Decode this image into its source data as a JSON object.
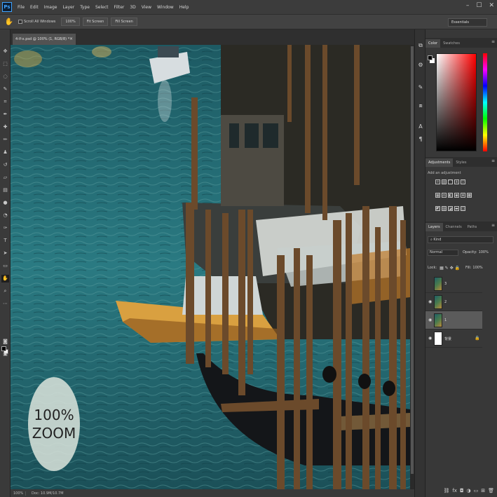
{
  "app": {
    "logo": "Ps"
  },
  "menu": [
    "File",
    "Edit",
    "Image",
    "Layer",
    "Type",
    "Select",
    "Filter",
    "3D",
    "View",
    "Window",
    "Help"
  ],
  "window_controls": {
    "minimize": "–",
    "restore": "☐",
    "close": "✕"
  },
  "options": {
    "tool_icon": "hand-icon",
    "scroll_all_label": "Scroll All Windows",
    "btn_100": "100%",
    "btn_fit": "Fit Screen",
    "btn_fill": "Fill Screen",
    "workspace": "Essentials"
  },
  "document": {
    "tab_title": "4-lf-x.psd @ 100% (1, RGB/8) *",
    "close": "×",
    "zoom_text_line1": "100%",
    "zoom_text_line2": "ZOOM"
  },
  "status": {
    "zoom": "100%",
    "doc": "Doc: 10.9M/10.7M"
  },
  "color_panel": {
    "tabs": [
      "Color",
      "Swatches"
    ]
  },
  "adjustments_panel": {
    "tabs": [
      "Adjustments",
      "Styles"
    ],
    "hint": "Add an adjustment"
  },
  "layers_panel": {
    "tabs": [
      "Layers",
      "Channels",
      "Paths"
    ],
    "filter": "Kind",
    "blend_mode": "Normal",
    "opacity_label": "Opacity:",
    "opacity_value": "100%",
    "lock_label": "Lock:",
    "fill_label": "Fill:",
    "fill_value": "100%",
    "layers": [
      {
        "name": "3",
        "visible": false,
        "selected": false,
        "white": false
      },
      {
        "name": "2",
        "visible": true,
        "selected": false,
        "white": false
      },
      {
        "name": "1",
        "visible": true,
        "selected": true,
        "white": false
      },
      {
        "name": "背景",
        "visible": true,
        "selected": false,
        "white": true
      }
    ]
  },
  "colors": {
    "canvas_water": "#2e6b73",
    "accent": "#3fa3ff"
  }
}
